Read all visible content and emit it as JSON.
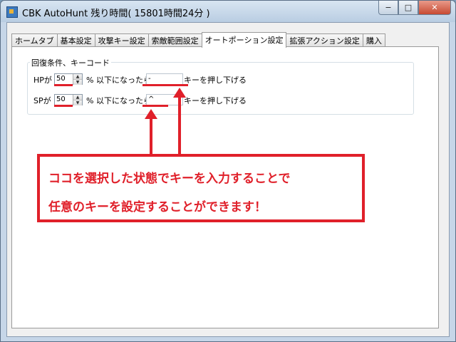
{
  "window": {
    "title": "CBK AutoHunt 残り時間( 15801時間24分 )",
    "controls": {
      "minimize": "−",
      "maximize": "□",
      "close": "✕"
    }
  },
  "tabs": [
    {
      "label": "ホームタブ",
      "active": false
    },
    {
      "label": "基本設定",
      "active": false
    },
    {
      "label": "攻撃キー設定",
      "active": false
    },
    {
      "label": "索敵範囲設定",
      "active": false
    },
    {
      "label": "オートポーション設定",
      "active": true
    },
    {
      "label": "拡張アクション設定",
      "active": false
    },
    {
      "label": "購入",
      "active": false
    }
  ],
  "group": {
    "title": "回復条件、キーコード",
    "rows": [
      {
        "prefix": "HPが",
        "value": "50",
        "middle": "% 以下になったら",
        "key": "-",
        "suffix": "キーを押し下げる"
      },
      {
        "prefix": "SPが",
        "value": "50",
        "middle": "% 以下になったら",
        "key": "^",
        "suffix": "キーを押し下げる"
      }
    ]
  },
  "annotation": {
    "line1": "ココを選択した状態でキーを入力することで",
    "line2": "任意のキーを設定することができます！",
    "color": "#e0202a"
  }
}
